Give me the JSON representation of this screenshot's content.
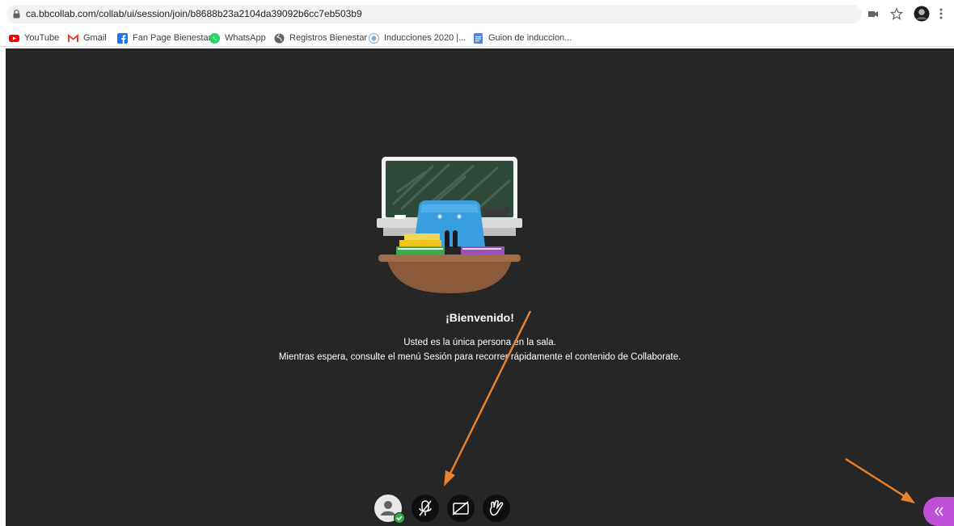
{
  "browser": {
    "url": "ca.bbcollab.com/collab/ui/session/join/b8688b23a2104da39092b6cc7eb503b9",
    "bookmarks": [
      {
        "label": "YouTube",
        "icon": "youtube-icon"
      },
      {
        "label": "Gmail",
        "icon": "gmail-icon"
      },
      {
        "label": "Fan Page Bienestar",
        "icon": "facebook-icon"
      },
      {
        "label": "WhatsApp",
        "icon": "whatsapp-icon"
      },
      {
        "label": "Registros Bienestar",
        "icon": "globe-icon"
      },
      {
        "label": "Inducciones 2020 |...",
        "icon": "site-icon"
      },
      {
        "label": "Guion de induccion...",
        "icon": "docs-icon"
      }
    ],
    "toolbar_icons": [
      "camera-icon",
      "star-icon",
      "profile-avatar",
      "menu-icon"
    ]
  },
  "session": {
    "title": "¡Bienvenido!",
    "line1": "Usted es la única persona en la sala.",
    "line2": "Mientras espera, consulte el menú Sesión para recorrer rápidamente el contenido de Collaborate."
  },
  "controls": [
    "avatar-status",
    "microphone-off",
    "camera-off",
    "raise-hand"
  ],
  "colors": {
    "stage_bg": "#262626",
    "panel_button": "#c04fd8",
    "annotation_arrow": "#e8822e",
    "status_green": "#2ea84a"
  }
}
